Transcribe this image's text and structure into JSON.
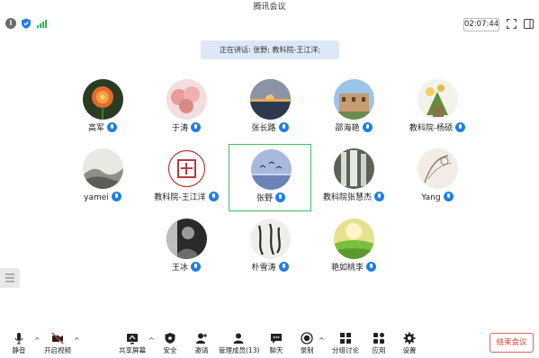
{
  "window": {
    "title": "腾讯会议"
  },
  "status": {
    "timer": "02:07:44"
  },
  "speaking": {
    "text": "正在讲话: 张野; 教科院-王江洋;"
  },
  "participants": [
    {
      "name": "高军"
    },
    {
      "name": "于涛"
    },
    {
      "name": "张长路"
    },
    {
      "name": "邵海艳"
    },
    {
      "name": "教科院-杨硕"
    },
    {
      "name": "yamei"
    },
    {
      "name": "教科院-王江洋"
    },
    {
      "name": "张野",
      "active": true
    },
    {
      "name": "教科院张慧杰"
    },
    {
      "name": "Yang"
    },
    {
      "name": "王冰"
    },
    {
      "name": "朴雪涛"
    },
    {
      "name": "艳如桃李"
    }
  ],
  "toolbar": {
    "mute": "静音",
    "video": "开启视频",
    "share": "共享屏幕",
    "security": "安全",
    "invite": "邀请",
    "members": "管理成员(13)",
    "chat": "聊天",
    "record": "录制",
    "breakout": "分组讨论",
    "apps": "应用",
    "settings": "设置",
    "end": "结束会议"
  },
  "colors": {
    "accent": "#1f7fe6",
    "active_border": "#3fbf62",
    "end": "#e03a3a"
  }
}
